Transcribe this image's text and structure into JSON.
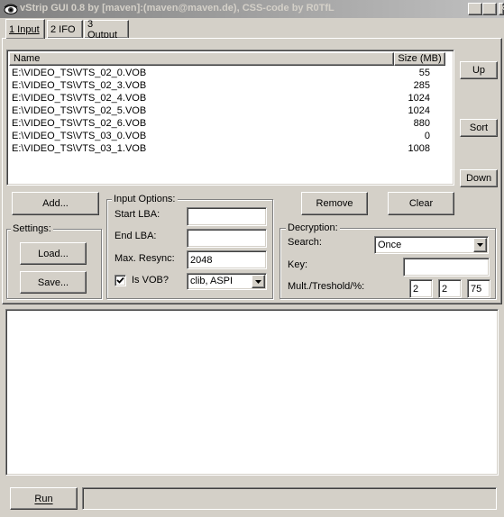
{
  "window": {
    "title": "vStrip GUI 0.8 by [maven]:(maven@maven.de), CSS-code by R0TfL",
    "minimize": "_",
    "maximize": "□",
    "close": "×"
  },
  "tabs": [
    {
      "label": "1 Input"
    },
    {
      "label": "2 IFO"
    },
    {
      "label": "3 Output"
    }
  ],
  "filelist": {
    "columns": [
      "Name",
      "Size (MB)"
    ],
    "rows": [
      {
        "name": "E:\\VIDEO_TS\\VTS_02_0.VOB",
        "size": "55"
      },
      {
        "name": "E:\\VIDEO_TS\\VTS_02_3.VOB",
        "size": "285"
      },
      {
        "name": "E:\\VIDEO_TS\\VTS_02_4.VOB",
        "size": "1024"
      },
      {
        "name": "E:\\VIDEO_TS\\VTS_02_5.VOB",
        "size": "1024"
      },
      {
        "name": "E:\\VIDEO_TS\\VTS_02_6.VOB",
        "size": "880"
      },
      {
        "name": "E:\\VIDEO_TS\\VTS_03_0.VOB",
        "size": "0"
      },
      {
        "name": "E:\\VIDEO_TS\\VTS_03_1.VOB",
        "size": "1008"
      }
    ]
  },
  "side_buttons": {
    "up": "Up",
    "sort": "Sort",
    "down": "Down"
  },
  "buttons": {
    "add": "Add...",
    "remove": "Remove",
    "clear": "Clear",
    "run": "Run"
  },
  "settings": {
    "label": "Settings:",
    "load": "Load...",
    "save": "Save..."
  },
  "input_options": {
    "label": "Input Options:",
    "start_lba_label": "Start LBA:",
    "start_lba_value": "",
    "end_lba_label": "End LBA:",
    "end_lba_value": "",
    "max_resync_label": "Max. Resync:",
    "max_resync_value": "2048",
    "is_vob_label": "Is VOB?",
    "is_vob_checked": true,
    "aspi_value": "clib, ASPI"
  },
  "decryption": {
    "label": "Decryption:",
    "search_label": "Search:",
    "search_value": "Once",
    "key_label": "Key:",
    "key_value": "",
    "mult_label": "Mult./Treshold/%:",
    "mult_1": "2",
    "mult_2": "2",
    "mult_3": "75"
  },
  "log": {
    "text": ""
  },
  "status": {
    "text": ""
  }
}
